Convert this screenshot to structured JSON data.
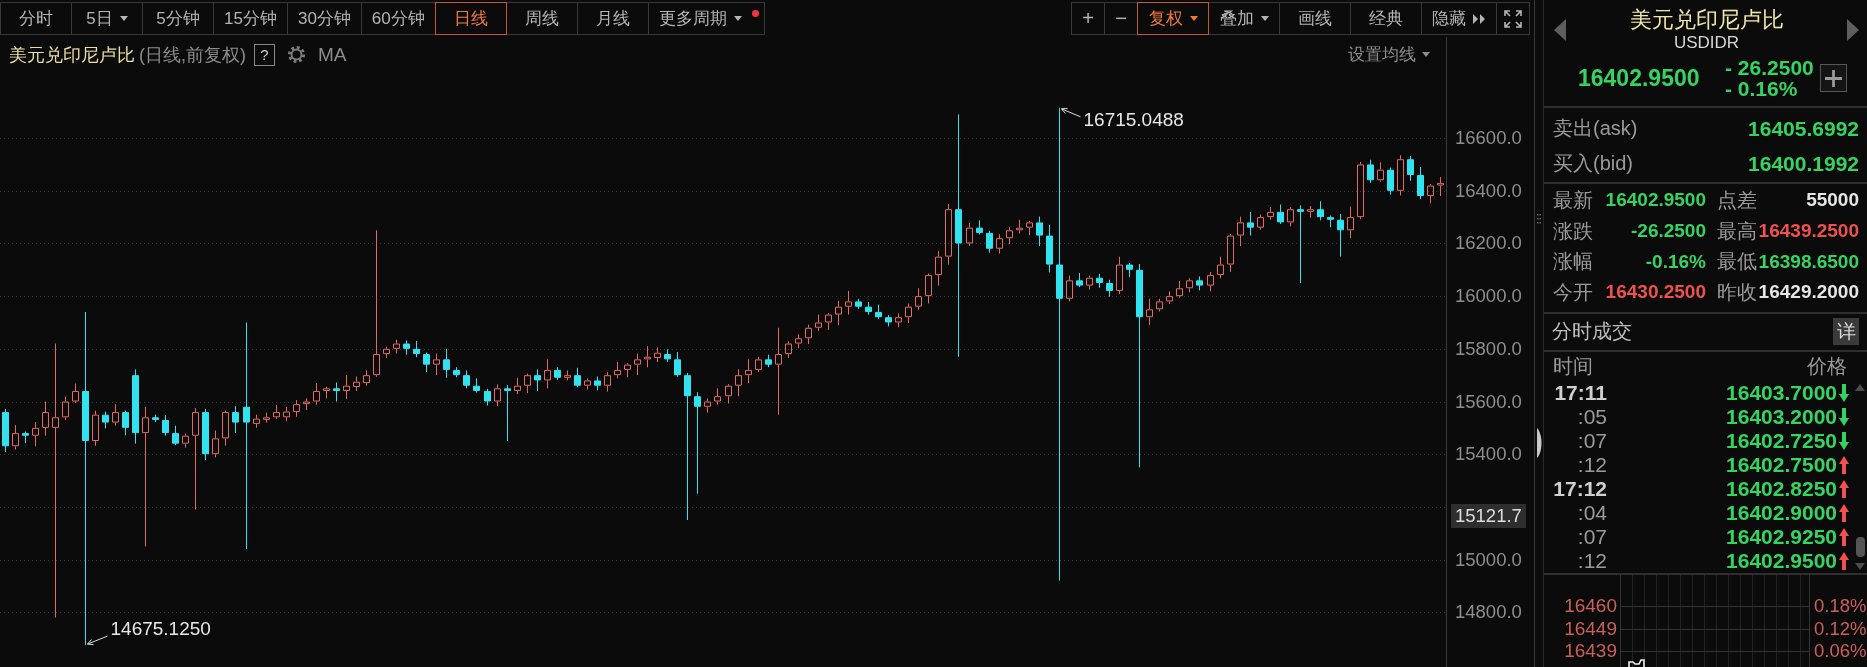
{
  "toolbar": {
    "periods": [
      {
        "label": "分时",
        "kind": "text",
        "selected": false,
        "notify": false
      },
      {
        "label": "5日",
        "kind": "menu",
        "selected": false,
        "notify": false
      },
      {
        "label": "5分钟",
        "kind": "text",
        "selected": false,
        "notify": false
      },
      {
        "label": "15分钟",
        "kind": "text",
        "selected": false,
        "notify": false
      },
      {
        "label": "30分钟",
        "kind": "text",
        "selected": false,
        "notify": false
      },
      {
        "label": "60分钟",
        "kind": "text",
        "selected": false,
        "notify": false
      },
      {
        "label": "日线",
        "kind": "text",
        "selected": true,
        "notify": false
      },
      {
        "label": "周线",
        "kind": "text",
        "selected": false,
        "notify": false
      },
      {
        "label": "月线",
        "kind": "text",
        "selected": false,
        "notify": false
      },
      {
        "label": "更多周期",
        "kind": "menu",
        "selected": false,
        "notify": true
      }
    ],
    "tools": [
      {
        "label": "+",
        "kind": "symbol",
        "active": false
      },
      {
        "label": "−",
        "kind": "symbol",
        "active": false
      },
      {
        "label": "复权",
        "kind": "menu",
        "active": true
      },
      {
        "label": "叠加",
        "kind": "menu",
        "active": false
      },
      {
        "label": "画线",
        "kind": "text",
        "active": false
      },
      {
        "label": "经典",
        "kind": "text",
        "active": false
      },
      {
        "label": "隐藏",
        "kind": "expand",
        "active": false
      },
      {
        "kind": "fullscreen",
        "active": false
      }
    ]
  },
  "chart_header": {
    "title": "美元兑印尼卢比",
    "subtitle": "(日线,前复权)",
    "help": "?",
    "indicator": "MA",
    "ma_setting": "设置均线"
  },
  "chart": {
    "chart_data": {
      "type": "candlestick",
      "grid": true,
      "ohlc": [
        [
          15560,
          15572,
          15408,
          15430
        ],
        [
          15430,
          15510,
          15418,
          15480
        ],
        [
          15480,
          15486,
          15442,
          15470
        ],
        [
          15470,
          15522,
          15430,
          15500
        ],
        [
          15500,
          15600,
          15470,
          15560
        ],
        [
          15500,
          15820,
          14780,
          15540
        ],
        [
          15540,
          15618,
          15530,
          15600
        ],
        [
          15600,
          15668,
          15594,
          15640
        ],
        [
          15640,
          15940,
          14675.125,
          15450
        ],
        [
          15450,
          15565,
          15432,
          15550
        ],
        [
          15550,
          15562,
          15498,
          15520
        ],
        [
          15520,
          15590,
          15508,
          15560
        ],
        [
          15560,
          15566,
          15472,
          15500
        ],
        [
          15700,
          15722,
          15440,
          15480
        ],
        [
          15480,
          15580,
          15050,
          15540
        ],
        [
          15540,
          15550,
          15522,
          15530
        ],
        [
          15530,
          15548,
          15470,
          15480
        ],
        [
          15480,
          15508,
          15434,
          15440
        ],
        [
          15440,
          15478,
          15425,
          15470
        ],
        [
          15470,
          15575,
          15190,
          15560
        ],
        [
          15560,
          15572,
          15378,
          15400
        ],
        [
          15400,
          15490,
          15388,
          15460
        ],
        [
          15460,
          15566,
          15432,
          15560
        ],
        [
          15560,
          15582,
          15480,
          15520
        ],
        [
          15580,
          15900,
          15040,
          15520
        ],
        [
          15515,
          15550,
          15500,
          15535
        ],
        [
          15530,
          15558,
          15520,
          15540
        ],
        [
          15540,
          15588,
          15534,
          15560
        ],
        [
          15540,
          15580,
          15525,
          15562
        ],
        [
          15560,
          15605,
          15542,
          15590
        ],
        [
          15590,
          15612,
          15568,
          15600
        ],
        [
          15600,
          15670,
          15588,
          15640
        ],
        [
          15640,
          15656,
          15612,
          15650
        ],
        [
          15650,
          15672,
          15600,
          15640
        ],
        [
          15640,
          15700,
          15610,
          15660
        ],
        [
          15655,
          15695,
          15640,
          15675
        ],
        [
          15670,
          15718,
          15660,
          15700
        ],
        [
          15700,
          16250,
          15694,
          15780
        ],
        [
          15780,
          15808,
          15765,
          15800
        ],
        [
          15800,
          15835,
          15782,
          15820
        ],
        [
          15820,
          15832,
          15778,
          15800
        ],
        [
          15800,
          15830,
          15768,
          15780
        ],
        [
          15780,
          15786,
          15712,
          15740
        ],
        [
          15740,
          15782,
          15700,
          15760
        ],
        [
          15760,
          15800,
          15690,
          15720
        ],
        [
          15720,
          15730,
          15692,
          15700
        ],
        [
          15700,
          15718,
          15650,
          15660
        ],
        [
          15660,
          15688,
          15634,
          15640
        ],
        [
          15640,
          15648,
          15585,
          15600
        ],
        [
          15600,
          15665,
          15582,
          15650
        ],
        [
          15650,
          15662,
          15450,
          15640
        ],
        [
          15640,
          15690,
          15628,
          15660
        ],
        [
          15660,
          15706,
          15632,
          15700
        ],
        [
          15700,
          15722,
          15640,
          15680
        ],
        [
          15680,
          15760,
          15650,
          15720
        ],
        [
          15720,
          15730,
          15682,
          15690
        ],
        [
          15690,
          15718,
          15680,
          15700
        ],
        [
          15700,
          15728,
          15654,
          15660
        ],
        [
          15660,
          15688,
          15645,
          15680
        ],
        [
          15680,
          15695,
          15642,
          15660
        ],
        [
          15660,
          15712,
          15638,
          15700
        ],
        [
          15700,
          15750,
          15688,
          15720
        ],
        [
          15720,
          15746,
          15692,
          15740
        ],
        [
          15740,
          15782,
          15700,
          15760
        ],
        [
          15760,
          15810,
          15730,
          15770
        ],
        [
          15765,
          15805,
          15750,
          15785
        ],
        [
          15780,
          15798,
          15750,
          15760
        ],
        [
          15760,
          15788,
          15694,
          15700
        ],
        [
          15700,
          15708,
          15150,
          15620
        ],
        [
          15620,
          15635,
          15250,
          15580
        ],
        [
          15580,
          15612,
          15558,
          15600
        ],
        [
          15600,
          15650,
          15588,
          15620
        ],
        [
          15620,
          15666,
          15592,
          15660
        ],
        [
          15660,
          15722,
          15620,
          15700
        ],
        [
          15700,
          15760,
          15670,
          15720
        ],
        [
          15720,
          15770,
          15712,
          15760
        ],
        [
          15760,
          15778,
          15730,
          15740
        ],
        [
          15740,
          15880,
          15550,
          15780
        ],
        [
          15780,
          15828,
          15765,
          15820
        ],
        [
          15820,
          15855,
          15802,
          15840
        ],
        [
          15840,
          15892,
          15818,
          15880
        ],
        [
          15880,
          15930,
          15868,
          15900
        ],
        [
          15900,
          15936,
          15872,
          15930
        ],
        [
          15930,
          15982,
          15890,
          15960
        ],
        [
          15960,
          16020,
          15930,
          15980
        ],
        [
          15980,
          15990,
          15952,
          15960
        ],
        [
          15960,
          15978,
          15930,
          15940
        ],
        [
          15940,
          15968,
          15914,
          15920
        ],
        [
          15920,
          15928,
          15885,
          15900
        ],
        [
          15900,
          15935,
          15882,
          15920
        ],
        [
          15920,
          15972,
          15898,
          15960
        ],
        [
          15960,
          16030,
          15948,
          16000
        ],
        [
          16000,
          16086,
          15972,
          16080
        ],
        [
          16080,
          16172,
          16040,
          16150
        ],
        [
          16150,
          16350,
          16120,
          16330
        ],
        [
          16330,
          16690,
          15770,
          16200
        ],
        [
          16200,
          16278,
          16190,
          16260
        ],
        [
          16260,
          16288,
          16234,
          16240
        ],
        [
          16240,
          16248,
          16165,
          16180
        ],
        [
          16180,
          16235,
          16162,
          16220
        ],
        [
          16220,
          16262,
          16198,
          16250
        ],
        [
          16250,
          16290,
          16238,
          16260
        ],
        [
          16260,
          16286,
          16232,
          16280
        ],
        [
          16280,
          16302,
          16190,
          16230
        ],
        [
          16230,
          16270,
          16090,
          16120
        ],
        [
          16120,
          16715.0488,
          14920,
          15990
        ],
        [
          15990,
          16078,
          15980,
          16060
        ],
        [
          16060,
          16088,
          16034,
          16040
        ],
        [
          16040,
          16078,
          16025,
          16070
        ],
        [
          16070,
          16085,
          16032,
          16050
        ],
        [
          16050,
          16062,
          15998,
          16020
        ],
        [
          16020,
          16150,
          16008,
          16120
        ],
        [
          16120,
          16126,
          16072,
          16100
        ],
        [
          16100,
          16122,
          15350,
          15920
        ],
        [
          15920,
          15990,
          15890,
          15950
        ],
        [
          15950,
          15990,
          15942,
          15980
        ],
        [
          15980,
          16018,
          15970,
          16000
        ],
        [
          16000,
          16058,
          15994,
          16030
        ],
        [
          16030,
          16068,
          16015,
          16060
        ],
        [
          16060,
          16075,
          16022,
          16040
        ],
        [
          16040,
          16092,
          16018,
          16080
        ],
        [
          16080,
          16150,
          16068,
          16120
        ],
        [
          16120,
          16236,
          16092,
          16230
        ],
        [
          16230,
          16302,
          16190,
          16280
        ],
        [
          16280,
          16320,
          16230,
          16260
        ],
        [
          16260,
          16310,
          16252,
          16300
        ],
        [
          16300,
          16338,
          16290,
          16320
        ],
        [
          16320,
          16348,
          16274,
          16280
        ],
        [
          16280,
          16338,
          16265,
          16330
        ],
        [
          16330,
          16345,
          16050,
          16320
        ],
        [
          16320,
          16342,
          16298,
          16330
        ],
        [
          16330,
          16360,
          16288,
          16300
        ],
        [
          16300,
          16306,
          16262,
          16290
        ],
        [
          16290,
          16312,
          16150,
          16250
        ],
        [
          16250,
          16340,
          16220,
          16300
        ],
        [
          16300,
          16510,
          16292,
          16500
        ],
        [
          16500,
          16518,
          16430,
          16440
        ],
        [
          16440,
          16508,
          16434,
          16480
        ],
        [
          16480,
          16488,
          16385,
          16400
        ],
        [
          16400,
          16535,
          16382,
          16520
        ],
        [
          16520,
          16532,
          16438,
          16460
        ],
        [
          16460,
          16490,
          16368,
          16380
        ],
        [
          16380,
          16426,
          16352,
          16420
        ],
        [
          16420,
          16452,
          16380,
          16430
        ]
      ],
      "ylim": [
        14592,
        16851
      ],
      "yticks": [
        {
          "value": 16600,
          "label": "16600.0"
        },
        {
          "value": 16400,
          "label": "16400.0"
        },
        {
          "value": 16200,
          "label": "16200.0"
        },
        {
          "value": 16000,
          "label": "16000.0"
        },
        {
          "value": 15800,
          "label": "15800.0"
        },
        {
          "value": 15600,
          "label": "15600.0"
        },
        {
          "value": 15400,
          "label": "15400.0"
        },
        {
          "value": 15000,
          "label": "15000.0"
        },
        {
          "value": 14800,
          "label": "14800.0"
        }
      ],
      "annotations": [
        "16715.0488",
        "14675.1250"
      ]
    },
    "price_marker": "15121.7"
  },
  "quote": {
    "title": "美元兑印尼卢比",
    "symbol": "USDIDR",
    "price": "16402.9500",
    "change": "- 26.2500",
    "change_percent": "- 0.16%",
    "color": "#35d462"
  },
  "ask_bid": [
    {
      "label": "卖出(ask)",
      "value": "16405.6992",
      "color": "#35d462"
    },
    {
      "label": "买入(bid)",
      "value": "16400.1992",
      "color": "#35d462"
    }
  ],
  "stats": [
    {
      "label": "最新",
      "value": "16402.9500",
      "color": "#35d462"
    },
    {
      "label": "点差",
      "value": "55000",
      "color": "#e6e6e6"
    },
    {
      "label": "涨跌",
      "value": "-26.2500",
      "color": "#35d462"
    },
    {
      "label": "最高",
      "value": "16439.2500",
      "color": "#f0514f"
    },
    {
      "label": "涨幅",
      "value": "-0.16%",
      "color": "#35d462"
    },
    {
      "label": "最低",
      "value": "16398.6500",
      "color": "#35d462"
    },
    {
      "label": "今开",
      "value": "16430.2500",
      "color": "#f0514f"
    },
    {
      "label": "昨收",
      "value": "16429.2000",
      "color": "#e6e6e6"
    }
  ],
  "trades": {
    "title": "分时成交",
    "detail": "详",
    "columns": [
      "时间",
      "价格"
    ],
    "rows": [
      {
        "time": "17:11",
        "kind": "minute",
        "price": "16403.7000",
        "color": "#35d462",
        "uptick": false
      },
      {
        "time": ":05",
        "kind": "second",
        "price": "16403.2000",
        "color": "#35d462",
        "uptick": false
      },
      {
        "time": ":07",
        "kind": "second",
        "price": "16402.7250",
        "color": "#35d462",
        "uptick": false
      },
      {
        "time": ":12",
        "kind": "second",
        "price": "16402.7500",
        "color": "#35d462",
        "uptick": true
      },
      {
        "time": "17:12",
        "kind": "minute",
        "price": "16402.8250",
        "color": "#35d462",
        "uptick": true
      },
      {
        "time": ":04",
        "kind": "second",
        "price": "16402.9000",
        "color": "#35d462",
        "uptick": true
      },
      {
        "time": ":07",
        "kind": "second",
        "price": "16402.9250",
        "color": "#35d462",
        "uptick": true
      },
      {
        "time": ":12",
        "kind": "second",
        "price": "16402.9500",
        "color": "#35d462",
        "uptick": true
      }
    ]
  },
  "intraday": {
    "rows": [
      {
        "price": "16460",
        "percent": "0.18%",
        "color": "#cc5f5a"
      },
      {
        "price": "16449",
        "percent": "0.12%",
        "color": "#cc5f5a"
      },
      {
        "price": "16439",
        "percent": "0.06%",
        "color": "#cc5f5a"
      }
    ]
  }
}
